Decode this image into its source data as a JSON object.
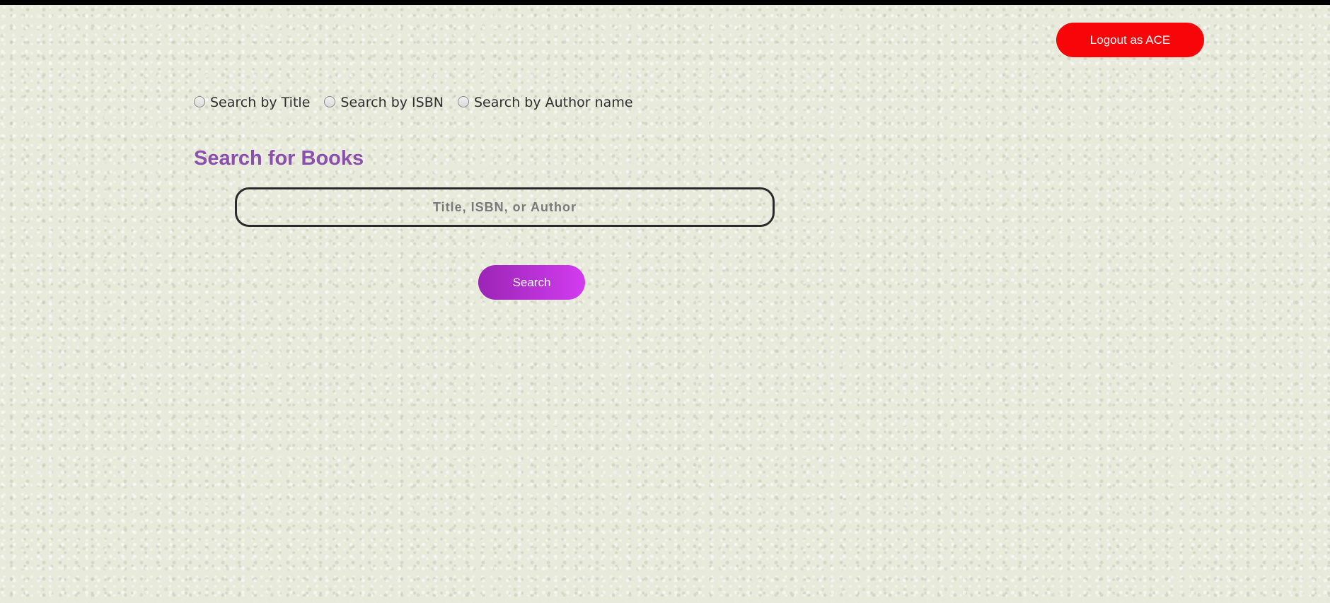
{
  "header": {
    "logout_label": "Logout as ACE"
  },
  "search_options": [
    {
      "label": "Search by Title",
      "selected": false
    },
    {
      "label": "Search by ISBN",
      "selected": false
    },
    {
      "label": "Search by Author name",
      "selected": false
    }
  ],
  "main": {
    "title": "Search for Books",
    "search_input": {
      "placeholder": "Title, ISBN, or Author",
      "value": ""
    },
    "search_button_label": "Search"
  },
  "colors": {
    "top_bar": "#000000",
    "logout_button": "#f8050a",
    "title": "#8b4fae",
    "search_button_start": "#9b24b5",
    "search_button_end": "#d23cf0"
  }
}
